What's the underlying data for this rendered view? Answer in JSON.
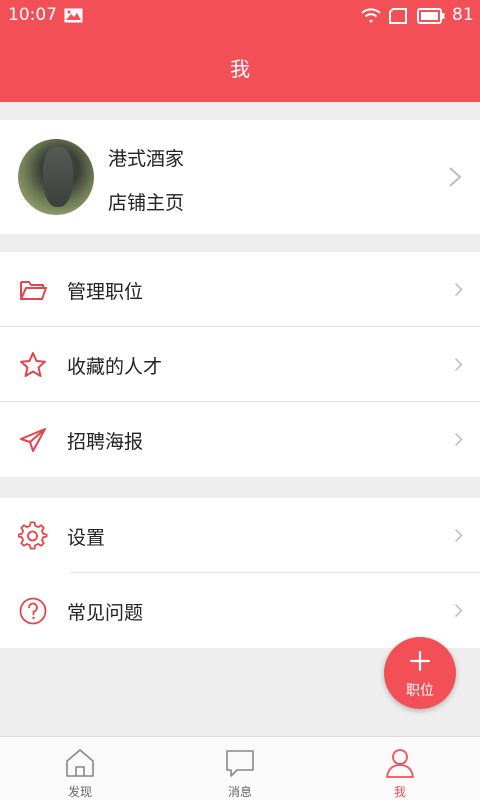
{
  "status_bar": {
    "time": "10:07",
    "battery": "81"
  },
  "header": {
    "title": "我"
  },
  "profile": {
    "shop_name": "港式酒家",
    "shop_home": "店铺主页"
  },
  "menu_group_1": [
    {
      "label": "管理职位",
      "icon": "folder-icon"
    },
    {
      "label": "收藏的人才",
      "icon": "star-icon"
    },
    {
      "label": "招聘海报",
      "icon": "paper-plane-icon"
    }
  ],
  "menu_group_2": [
    {
      "label": "设置",
      "icon": "gear-icon"
    },
    {
      "label": "常见问题",
      "icon": "question-icon"
    }
  ],
  "fab": {
    "label": "职位"
  },
  "bottom_nav": [
    {
      "label": "发现",
      "icon": "home-icon",
      "active": false
    },
    {
      "label": "消息",
      "icon": "message-icon",
      "active": false
    },
    {
      "label": "我",
      "icon": "person-icon",
      "active": true
    }
  ],
  "colors": {
    "accent": "#f25056",
    "icon_red": "#e4444b",
    "chevron": "#bdbdbd"
  }
}
